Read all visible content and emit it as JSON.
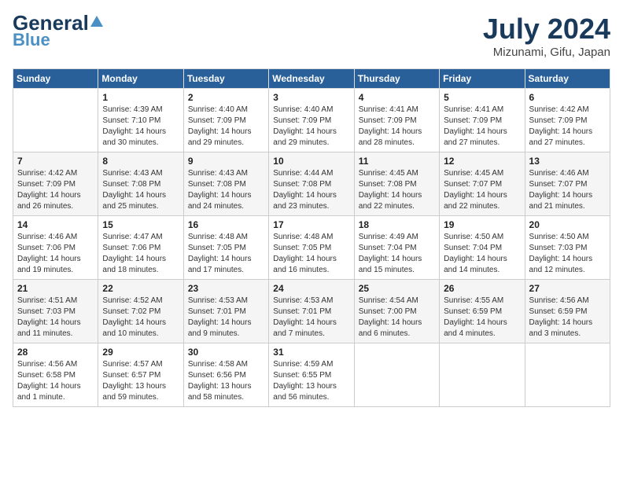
{
  "header": {
    "logo_general": "General",
    "logo_blue": "Blue",
    "main_title": "July 2024",
    "subtitle": "Mizunami, Gifu, Japan"
  },
  "calendar": {
    "days_of_week": [
      "Sunday",
      "Monday",
      "Tuesday",
      "Wednesday",
      "Thursday",
      "Friday",
      "Saturday"
    ],
    "weeks": [
      [
        {
          "day": "",
          "info": ""
        },
        {
          "day": "1",
          "info": "Sunrise: 4:39 AM\nSunset: 7:10 PM\nDaylight: 14 hours\nand 30 minutes."
        },
        {
          "day": "2",
          "info": "Sunrise: 4:40 AM\nSunset: 7:09 PM\nDaylight: 14 hours\nand 29 minutes."
        },
        {
          "day": "3",
          "info": "Sunrise: 4:40 AM\nSunset: 7:09 PM\nDaylight: 14 hours\nand 29 minutes."
        },
        {
          "day": "4",
          "info": "Sunrise: 4:41 AM\nSunset: 7:09 PM\nDaylight: 14 hours\nand 28 minutes."
        },
        {
          "day": "5",
          "info": "Sunrise: 4:41 AM\nSunset: 7:09 PM\nDaylight: 14 hours\nand 27 minutes."
        },
        {
          "day": "6",
          "info": "Sunrise: 4:42 AM\nSunset: 7:09 PM\nDaylight: 14 hours\nand 27 minutes."
        }
      ],
      [
        {
          "day": "7",
          "info": "Sunrise: 4:42 AM\nSunset: 7:09 PM\nDaylight: 14 hours\nand 26 minutes."
        },
        {
          "day": "8",
          "info": "Sunrise: 4:43 AM\nSunset: 7:08 PM\nDaylight: 14 hours\nand 25 minutes."
        },
        {
          "day": "9",
          "info": "Sunrise: 4:43 AM\nSunset: 7:08 PM\nDaylight: 14 hours\nand 24 minutes."
        },
        {
          "day": "10",
          "info": "Sunrise: 4:44 AM\nSunset: 7:08 PM\nDaylight: 14 hours\nand 23 minutes."
        },
        {
          "day": "11",
          "info": "Sunrise: 4:45 AM\nSunset: 7:08 PM\nDaylight: 14 hours\nand 22 minutes."
        },
        {
          "day": "12",
          "info": "Sunrise: 4:45 AM\nSunset: 7:07 PM\nDaylight: 14 hours\nand 22 minutes."
        },
        {
          "day": "13",
          "info": "Sunrise: 4:46 AM\nSunset: 7:07 PM\nDaylight: 14 hours\nand 21 minutes."
        }
      ],
      [
        {
          "day": "14",
          "info": "Sunrise: 4:46 AM\nSunset: 7:06 PM\nDaylight: 14 hours\nand 19 minutes."
        },
        {
          "day": "15",
          "info": "Sunrise: 4:47 AM\nSunset: 7:06 PM\nDaylight: 14 hours\nand 18 minutes."
        },
        {
          "day": "16",
          "info": "Sunrise: 4:48 AM\nSunset: 7:05 PM\nDaylight: 14 hours\nand 17 minutes."
        },
        {
          "day": "17",
          "info": "Sunrise: 4:48 AM\nSunset: 7:05 PM\nDaylight: 14 hours\nand 16 minutes."
        },
        {
          "day": "18",
          "info": "Sunrise: 4:49 AM\nSunset: 7:04 PM\nDaylight: 14 hours\nand 15 minutes."
        },
        {
          "day": "19",
          "info": "Sunrise: 4:50 AM\nSunset: 7:04 PM\nDaylight: 14 hours\nand 14 minutes."
        },
        {
          "day": "20",
          "info": "Sunrise: 4:50 AM\nSunset: 7:03 PM\nDaylight: 14 hours\nand 12 minutes."
        }
      ],
      [
        {
          "day": "21",
          "info": "Sunrise: 4:51 AM\nSunset: 7:03 PM\nDaylight: 14 hours\nand 11 minutes."
        },
        {
          "day": "22",
          "info": "Sunrise: 4:52 AM\nSunset: 7:02 PM\nDaylight: 14 hours\nand 10 minutes."
        },
        {
          "day": "23",
          "info": "Sunrise: 4:53 AM\nSunset: 7:01 PM\nDaylight: 14 hours\nand 9 minutes."
        },
        {
          "day": "24",
          "info": "Sunrise: 4:53 AM\nSunset: 7:01 PM\nDaylight: 14 hours\nand 7 minutes."
        },
        {
          "day": "25",
          "info": "Sunrise: 4:54 AM\nSunset: 7:00 PM\nDaylight: 14 hours\nand 6 minutes."
        },
        {
          "day": "26",
          "info": "Sunrise: 4:55 AM\nSunset: 6:59 PM\nDaylight: 14 hours\nand 4 minutes."
        },
        {
          "day": "27",
          "info": "Sunrise: 4:56 AM\nSunset: 6:59 PM\nDaylight: 14 hours\nand 3 minutes."
        }
      ],
      [
        {
          "day": "28",
          "info": "Sunrise: 4:56 AM\nSunset: 6:58 PM\nDaylight: 14 hours\nand 1 minute."
        },
        {
          "day": "29",
          "info": "Sunrise: 4:57 AM\nSunset: 6:57 PM\nDaylight: 13 hours\nand 59 minutes."
        },
        {
          "day": "30",
          "info": "Sunrise: 4:58 AM\nSunset: 6:56 PM\nDaylight: 13 hours\nand 58 minutes."
        },
        {
          "day": "31",
          "info": "Sunrise: 4:59 AM\nSunset: 6:55 PM\nDaylight: 13 hours\nand 56 minutes."
        },
        {
          "day": "",
          "info": ""
        },
        {
          "day": "",
          "info": ""
        },
        {
          "day": "",
          "info": ""
        }
      ]
    ]
  }
}
